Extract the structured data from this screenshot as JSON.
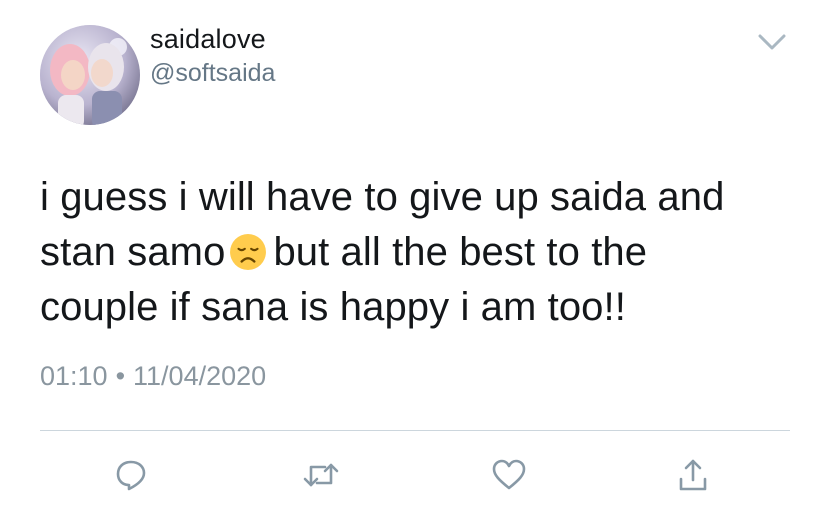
{
  "user": {
    "display_name": "saidalove",
    "handle": "@softsaida",
    "avatar": "profile-photo"
  },
  "tweet": {
    "lines": [
      "i guess i will have to give up saida and",
      "stan samo",
      "but all the best to the",
      "couple if sana is happy i am too!!"
    ],
    "emoji": "disappointed-face",
    "time": "01:10",
    "separator": "•",
    "date": "11/04/2020"
  },
  "actions": {
    "reply_icon": "reply-icon",
    "retweet_icon": "retweet-icon",
    "like_icon": "heart-icon",
    "share_icon": "share-icon"
  },
  "colors": {
    "text": "#14171a",
    "secondary": "#657786",
    "icon": "#8899a6",
    "divider": "#ccd6dd"
  }
}
